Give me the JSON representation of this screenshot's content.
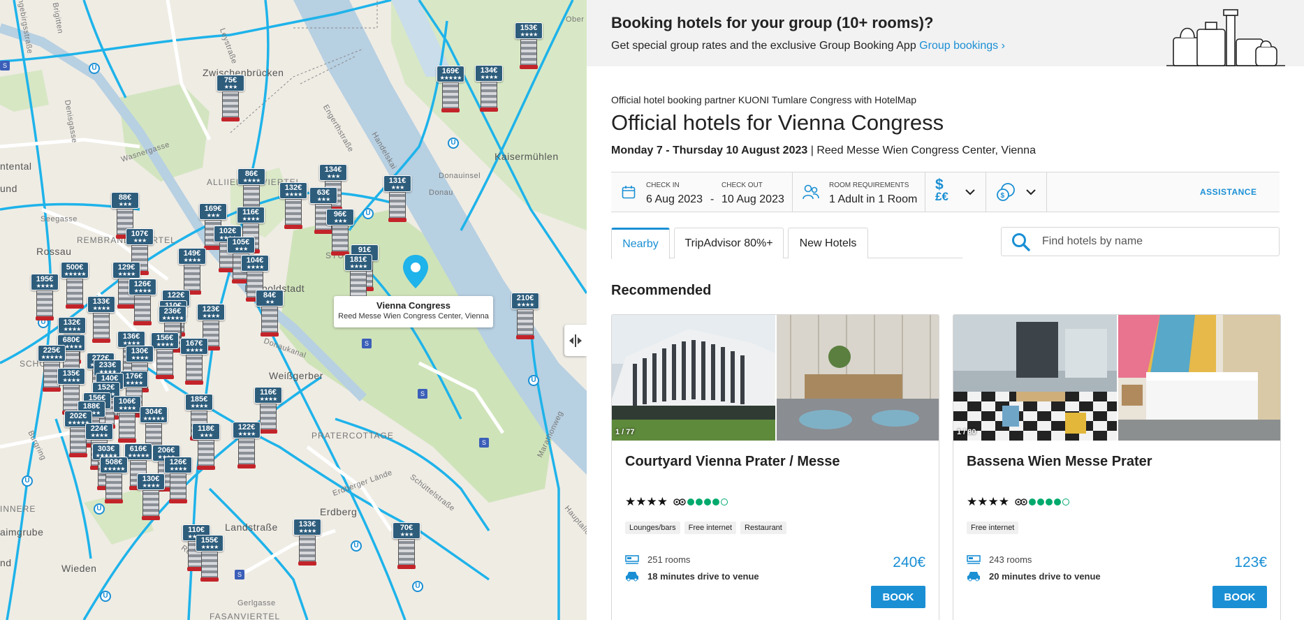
{
  "banner": {
    "title": "Booking hotels for your group (10+ rooms)?",
    "text": "Get special group rates and the exclusive Group Booking App",
    "link": "Group bookings ›"
  },
  "header": {
    "partner_line": "Official hotel booking partner KUONI Tumlare Congress with HotelMap",
    "title": "Official hotels for Vienna Congress",
    "dates": "Monday 7 - Thursday 10 August 2023",
    "venue": " | Reed Messe Wien Congress Center, Vienna"
  },
  "search_bar": {
    "checkin_label": "Check in",
    "checkin_value": "6 Aug 2023",
    "dash": "-",
    "checkout_label": "Check out",
    "checkout_value": "10 Aug 2023",
    "rooms_label": "Room requirements",
    "rooms_value": "1 Adult in 1 Room",
    "assistance": "ASSISTANCE"
  },
  "tabs": [
    {
      "label": "Nearby",
      "active": true
    },
    {
      "label": "TripAdvisor 80%+",
      "active": false
    },
    {
      "label": "New Hotels",
      "active": false
    }
  ],
  "hotel_search": {
    "placeholder": "Find hotels by name"
  },
  "recommended_title": "Recommended",
  "hotels": [
    {
      "photo_count": "1 / 77",
      "name": "Courtyard Vienna Prater / Messe",
      "stars": "★★★★",
      "tripadvisor_dots": 4,
      "amenities": [
        "Lounges/bars",
        "Free internet",
        "Restaurant"
      ],
      "rooms": "251 rooms",
      "drive": "18 minutes drive to venue",
      "price": "240€",
      "book_label": "BOOK"
    },
    {
      "photo_count": "1 / 80",
      "name": "Bassena Wien Messe Prater",
      "stars": "★★★★",
      "tripadvisor_dots": 4,
      "amenities": [
        "Free internet"
      ],
      "rooms": "243 rooms",
      "drive": "20 minutes drive to venue",
      "price": "123€",
      "book_label": "BOOK"
    }
  ],
  "map": {
    "venue_title": "Vienna Congress",
    "venue_subtitle": "Reed Messe Wien Congress Center, Vienna",
    "labels": {
      "zwischenbruecken": "Zwischenbrücken",
      "kaisermuehlen": "Kaisermühlen",
      "rossau": "Rossau",
      "leopoldstadt": "Leopoldstadt",
      "weissgerber": "Weißgerber",
      "erdberg": "Erdberg",
      "landstrasse": "Landstraße",
      "wieden": "Wieden",
      "pratercottage": "PRATERCOTTAGE",
      "stuwer": "STUWER",
      "alliiertenviertel": "ALLIIERTENVIERTEL",
      "rembrandt": "REMBRANDTVIERTEL",
      "schotten": "SCHOT",
      "donauinsel": "Donauinsel",
      "donau": "Donau",
      "seegasse": "Seegasse",
      "wasnergasse": "Wasnergasse",
      "leystrasse": "Leystraße",
      "engerthstrasse": "Engerthstraße",
      "handelskai": "Handelskai",
      "denisgasse": "Denisgasse",
      "donaukanal": "Donaukanal",
      "stadiongasse": "Schüttelstraße",
      "erdbergerlaende": "Erdberger Lände",
      "burgring": "Burgring",
      "marathonweg": "Marathonweg",
      "hauptallee": "Hauptallee",
      "rennweg": "Rennweg",
      "gerlgasse": "Gerlgasse",
      "fasanviertel": "FASANVIERTEL",
      "innere": "INNERE",
      "aimgrube": "aimgrube",
      "ntental": "ntental",
      "und": "und",
      "nd": "nd",
      "ober": "Ober",
      "brigittenau": "Brigitten",
      "siegfried": "ingebirgsstraße"
    },
    "prices": [
      {
        "price": "153€",
        "stars": "★★★★"
      },
      {
        "price": "169€",
        "stars": "★★★★★"
      },
      {
        "price": "134€",
        "stars": "★★★★"
      },
      {
        "price": "75€",
        "stars": "★★★"
      },
      {
        "price": "86€",
        "stars": "★★★★"
      },
      {
        "price": "134€",
        "stars": "★★★"
      },
      {
        "price": "131€",
        "stars": "★★★"
      },
      {
        "price": "132€",
        "stars": "★★★★"
      },
      {
        "price": "63€",
        "stars": "★★★"
      },
      {
        "price": "96€",
        "stars": "★★★"
      },
      {
        "price": "88€",
        "stars": "★★★"
      },
      {
        "price": "169€",
        "stars": "★★★"
      },
      {
        "price": "116€",
        "stars": "★★★★"
      },
      {
        "price": "107€",
        "stars": "★★★"
      },
      {
        "price": "102€",
        "stars": "★★★★"
      },
      {
        "price": "105€",
        "stars": "★★★"
      },
      {
        "price": "91€",
        "stars": "★★★"
      },
      {
        "price": "181€",
        "stars": "★★★★"
      },
      {
        "price": "149€",
        "stars": "★★★★"
      },
      {
        "price": "104€",
        "stars": "★★★★"
      },
      {
        "price": "500€",
        "stars": "★★★★★"
      },
      {
        "price": "129€",
        "stars": "★★★★"
      },
      {
        "price": "195€",
        "stars": "★★★★"
      },
      {
        "price": "126€",
        "stars": "★★★★"
      },
      {
        "price": "84€",
        "stars": "★★"
      },
      {
        "price": "133€",
        "stars": "★★★★"
      },
      {
        "price": "122€",
        "stars": "★★★★"
      },
      {
        "price": "110€",
        "stars": "★★★★"
      },
      {
        "price": "236€",
        "stars": "★★★★★"
      },
      {
        "price": "123€",
        "stars": "★★★★"
      },
      {
        "price": "210€",
        "stars": "★★★★"
      },
      {
        "price": "132€",
        "stars": "★★★★"
      },
      {
        "price": "680€",
        "stars": "★★★★★"
      },
      {
        "price": "136€",
        "stars": "★★★★"
      },
      {
        "price": "156€",
        "stars": "★★★★"
      },
      {
        "price": "167€",
        "stars": "★★★★"
      },
      {
        "price": "225€",
        "stars": "★★★★★"
      },
      {
        "price": "272€",
        "stars": "★★★★★"
      },
      {
        "price": "130€",
        "stars": "★★★★"
      },
      {
        "price": "233€",
        "stars": "★★★★"
      },
      {
        "price": "176€",
        "stars": "★★★★"
      },
      {
        "price": "140€",
        "stars": "★★★★"
      },
      {
        "price": "135€",
        "stars": "★★★★"
      },
      {
        "price": "152€",
        "stars": "★★★★"
      },
      {
        "price": "156€",
        "stars": "★★★★"
      },
      {
        "price": "188€",
        "stars": "★★★★"
      },
      {
        "price": "185€",
        "stars": "★★★★"
      },
      {
        "price": "116€",
        "stars": "★★★★"
      },
      {
        "price": "106€",
        "stars": "★★★★"
      },
      {
        "price": "202€",
        "stars": "★★★★★"
      },
      {
        "price": "304€",
        "stars": "★★★★★"
      },
      {
        "price": "224€",
        "stars": "★★★★"
      },
      {
        "price": "118€",
        "stars": "★★★"
      },
      {
        "price": "122€",
        "stars": "★★★★"
      },
      {
        "price": "303€",
        "stars": "★★★★★"
      },
      {
        "price": "616€",
        "stars": "★★★★★"
      },
      {
        "price": "206€",
        "stars": "★★★★"
      },
      {
        "price": "508€",
        "stars": "★★★★★"
      },
      {
        "price": "126€",
        "stars": "★★★★"
      },
      {
        "price": "130€",
        "stars": "★★★★"
      },
      {
        "price": "133€",
        "stars": "★★★★"
      },
      {
        "price": "70€",
        "stars": "★★★"
      },
      {
        "price": "110€",
        "stars": "★★★★"
      },
      {
        "price": "155€",
        "stars": "★★★★"
      }
    ]
  },
  "colors": {
    "accent": "#1a8fd4",
    "pin_tag": "#2e5d7c",
    "tripadvisor": "#00aa6c",
    "roads": "#1eb3ea",
    "water": "#b7d0e2",
    "park": "#cfe3b9"
  }
}
